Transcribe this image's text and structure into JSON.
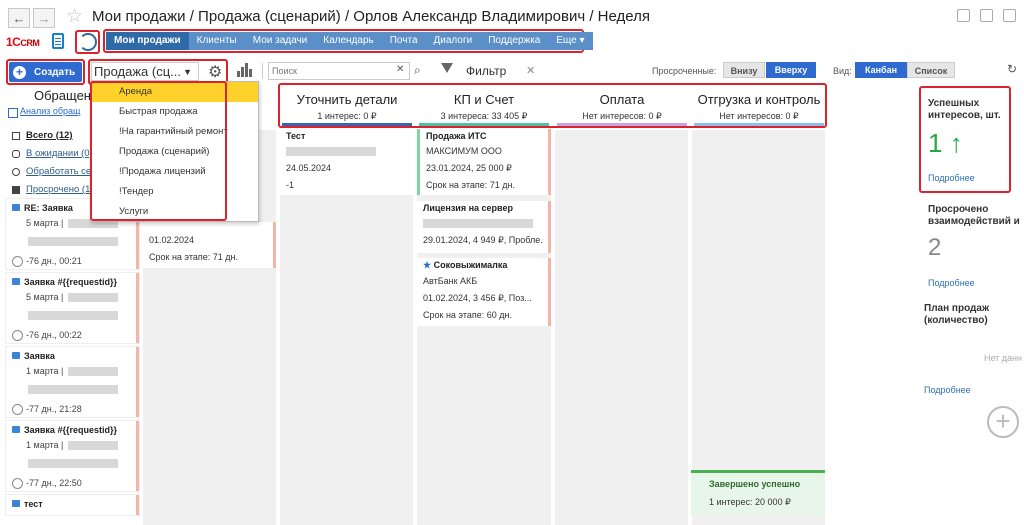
{
  "window": {
    "title": "Мои продажи / Продажа (сценарий) / Орлов Александр Владимирович / Неделя"
  },
  "topnav": {
    "tabs": [
      {
        "label": "Мои продажи",
        "active": true
      },
      {
        "label": "Клиенты"
      },
      {
        "label": "Мои задачи"
      },
      {
        "label": "Календарь"
      },
      {
        "label": "Почта"
      },
      {
        "label": "Диалоги"
      },
      {
        "label": "Поддержка"
      },
      {
        "label": "Еще"
      }
    ]
  },
  "logo": {
    "brand": "1С",
    "text": "CRM"
  },
  "toolbar": {
    "create_label": "Создать",
    "scenario_value": "Продажа (сц...",
    "search_placeholder": "Поиск",
    "filter_label": "Фильтр",
    "overdue_label": "Просроченные:",
    "overdue_down": "Внизу",
    "overdue_up": "Вверху",
    "view_label": "Вид:",
    "view_kanban": "Канбан",
    "view_list": "Список"
  },
  "scenario_menu": {
    "options": [
      "Аренда",
      "Быстрая продажа",
      "!На гарантийный ремонт",
      "Продажа (сценарий)",
      "!Продажа лицензий",
      "!Тендер",
      "Услуги"
    ],
    "selected": "Аренда"
  },
  "left_panel": {
    "title": "Обращени",
    "subtitle": "Анализ обращ",
    "stats": [
      {
        "label": "Всего (12)"
      },
      {
        "label": "В ожидании (0)"
      },
      {
        "label": "Обработать се"
      },
      {
        "label": "Просрочено (12"
      }
    ],
    "cards": [
      {
        "title": "RE: Заявка",
        "date": "5 марта | ",
        "footer": "-76 дн., 00:21"
      },
      {
        "title": "Заявка #{{requestid}}",
        "date": "5 марта | ",
        "footer": "-76 дн., 00:22"
      },
      {
        "title": "Заявка",
        "date": "1 марта | ",
        "footer": "-77 дн., 21:28"
      },
      {
        "title": "Заявка #{{requestid}}",
        "date": "1 марта | ",
        "footer": "-77 дн., 22:50"
      },
      {
        "title": "тест",
        "date": "",
        "footer": ""
      }
    ]
  },
  "stages": [
    {
      "name": "Уточнить детали",
      "summary": "1 интерес: 0 ₽",
      "color": "#3a63b0"
    },
    {
      "name": "КП и Счет",
      "summary": "3 интереса: 33 405 ₽",
      "color": "#4fc3a1"
    },
    {
      "name": "Оплата",
      "summary": "Нет интересов: 0 ₽",
      "color": "#c9a4e0"
    },
    {
      "name": "Отгрузка и контроль",
      "summary": "Нет интересов: 0 ₽",
      "color": "#8bbfe8"
    }
  ],
  "cards": {
    "col0_top": {
      "date": "01.02.2024",
      "stage": "Срок на этапе: 71 дн."
    },
    "col1_first": {
      "title": "Тест",
      "date": "24.05.2024",
      "num": "-1"
    },
    "col2_first": {
      "title": "Продажа ИТС",
      "client": "МАКСИМУМ ООО",
      "date": "23.01.2024, 25 000 ₽",
      "stage": "Срок на этапе: 71 дн."
    },
    "col2_second": {
      "title": "Лицензия на сервер",
      "date": "29.01.2024, 4 949 ₽, Пробле..."
    },
    "col2_third": {
      "title": "Соковыжималка",
      "client": "АвтБанк АКБ",
      "date": "01.02.2024, 3 456 ₽, Поз...",
      "stage": "Срок на этапе: 60 дн."
    }
  },
  "done": {
    "title": "Завершено успешно",
    "summary": "1 интерес: 20 000 ₽"
  },
  "widgets": {
    "success": {
      "title": "Успешных интересов, шт.",
      "value": "1",
      "arrow": "↑",
      "link": "Подробнее"
    },
    "overdue": {
      "title": "Просрочено взаимодействий и",
      "value": "2",
      "link": "Подробнее"
    },
    "plan": {
      "title": "План продаж (количество)",
      "empty": "Нет данн",
      "link": "Подробнее"
    }
  },
  "colors": {
    "accent": "#2e6ad0",
    "highlight": "#d9232d",
    "selected": "#ffd12b"
  }
}
